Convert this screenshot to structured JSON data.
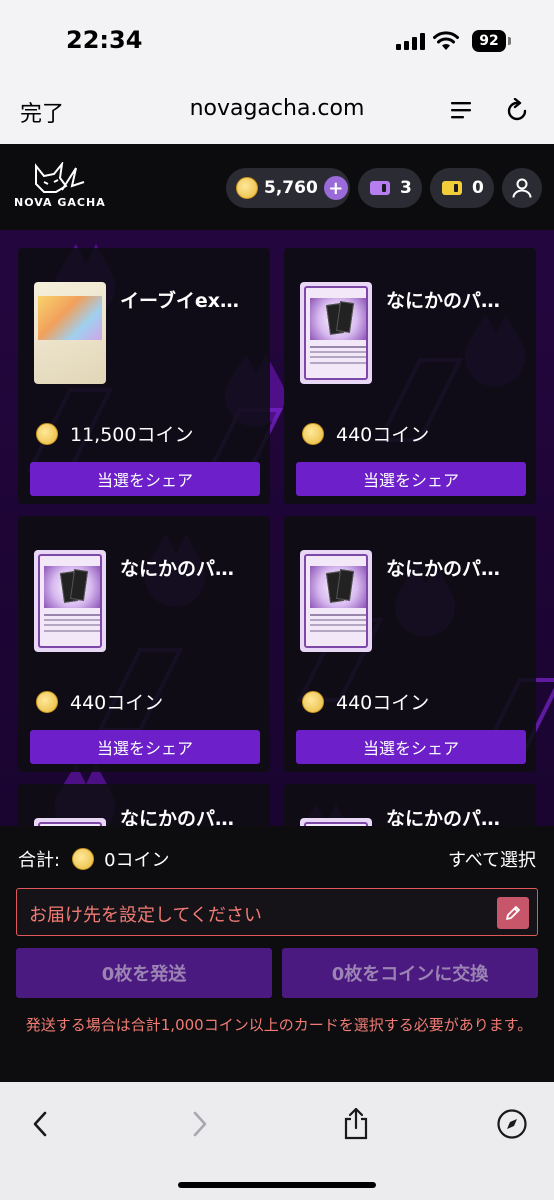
{
  "status_bar": {
    "time": "22:34",
    "battery": "92"
  },
  "browser": {
    "done_label": "完了",
    "url": "novagacha.com"
  },
  "header": {
    "logo_text": "NOVA GACHA",
    "coins": "5,760",
    "ticket_purple_count": "3",
    "ticket_yellow_count": "0"
  },
  "cards": [
    {
      "name": "イーブイex…",
      "price": "11,500コイン",
      "share_label": "当選をシェア",
      "kind": "eevee"
    },
    {
      "name": "なにかのパ…",
      "price": "440コイン",
      "share_label": "当選をシェア",
      "kind": "pack"
    },
    {
      "name": "なにかのパ…",
      "price": "440コイン",
      "share_label": "当選をシェア",
      "kind": "pack"
    },
    {
      "name": "なにかのパ…",
      "price": "440コイン",
      "share_label": "当選をシェア",
      "kind": "pack"
    },
    {
      "name": "なにかのパ…",
      "kind": "pack"
    },
    {
      "name": "なにかのパ…",
      "kind": "pack"
    }
  ],
  "panel": {
    "total_label": "合計:",
    "total_value": "0コイン",
    "select_all": "すべて選択",
    "address_placeholder": "お届け先を設定してください",
    "send_button": "0枚を発送",
    "exchange_button": "0枚をコインに交換",
    "warning": "発送する場合は合計1,000コイン以上のカードを選択する必要があります。"
  },
  "colors": {
    "accent_purple": "#6d1fc9",
    "warning_red": "#f07c74",
    "coin_gold": "#e7b93a"
  }
}
